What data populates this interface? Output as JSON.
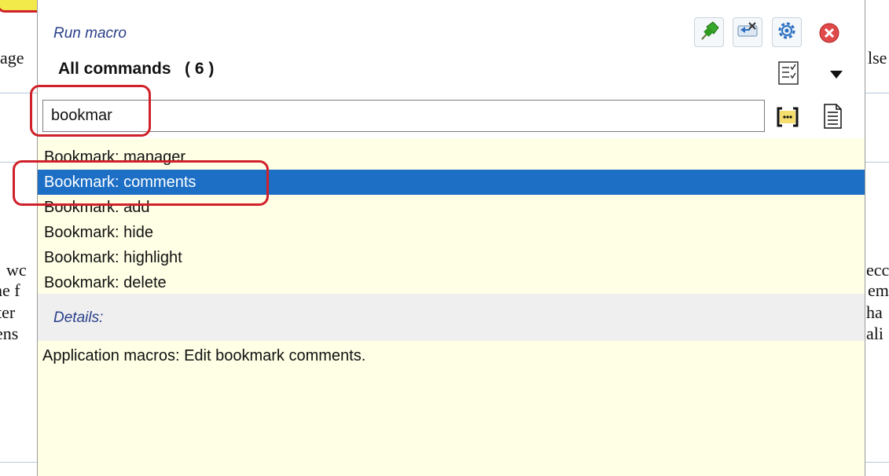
{
  "background": {
    "left_fragments": [
      "age",
      "wc",
      "he f",
      "ter",
      "ens"
    ],
    "right_fragments": [
      "lse",
      "ecc",
      "em",
      "ha",
      "ali"
    ]
  },
  "popup": {
    "title": "Run macro",
    "category_label": "All commands   ( 6 )",
    "toolbar": {
      "pin_icon": "pin-icon",
      "swap_icon": "swap-arrows-icon",
      "settings_icon": "gear-icon",
      "close_icon": "close-icon",
      "checklist_icon": "checklist-icon",
      "dropdown_icon": "chevron-down-icon",
      "expand_icon": "bracket-expand-icon",
      "document_icon": "document-icon"
    },
    "search": {
      "value": "bookmar"
    },
    "results": [
      "Bookmark: manager",
      "Bookmark: comments",
      "Bookmark: add",
      "Bookmark: hide",
      "Bookmark: highlight",
      "Bookmark: delete"
    ],
    "selected_index": 1,
    "details_label": "Details:",
    "details_text": "Application macros: Edit bookmark comments."
  },
  "colors": {
    "selection": "#1d6fc6",
    "list_background": "#ffffe6",
    "callout_red": "#d0202a",
    "title_blue": "#2a3f8a"
  }
}
